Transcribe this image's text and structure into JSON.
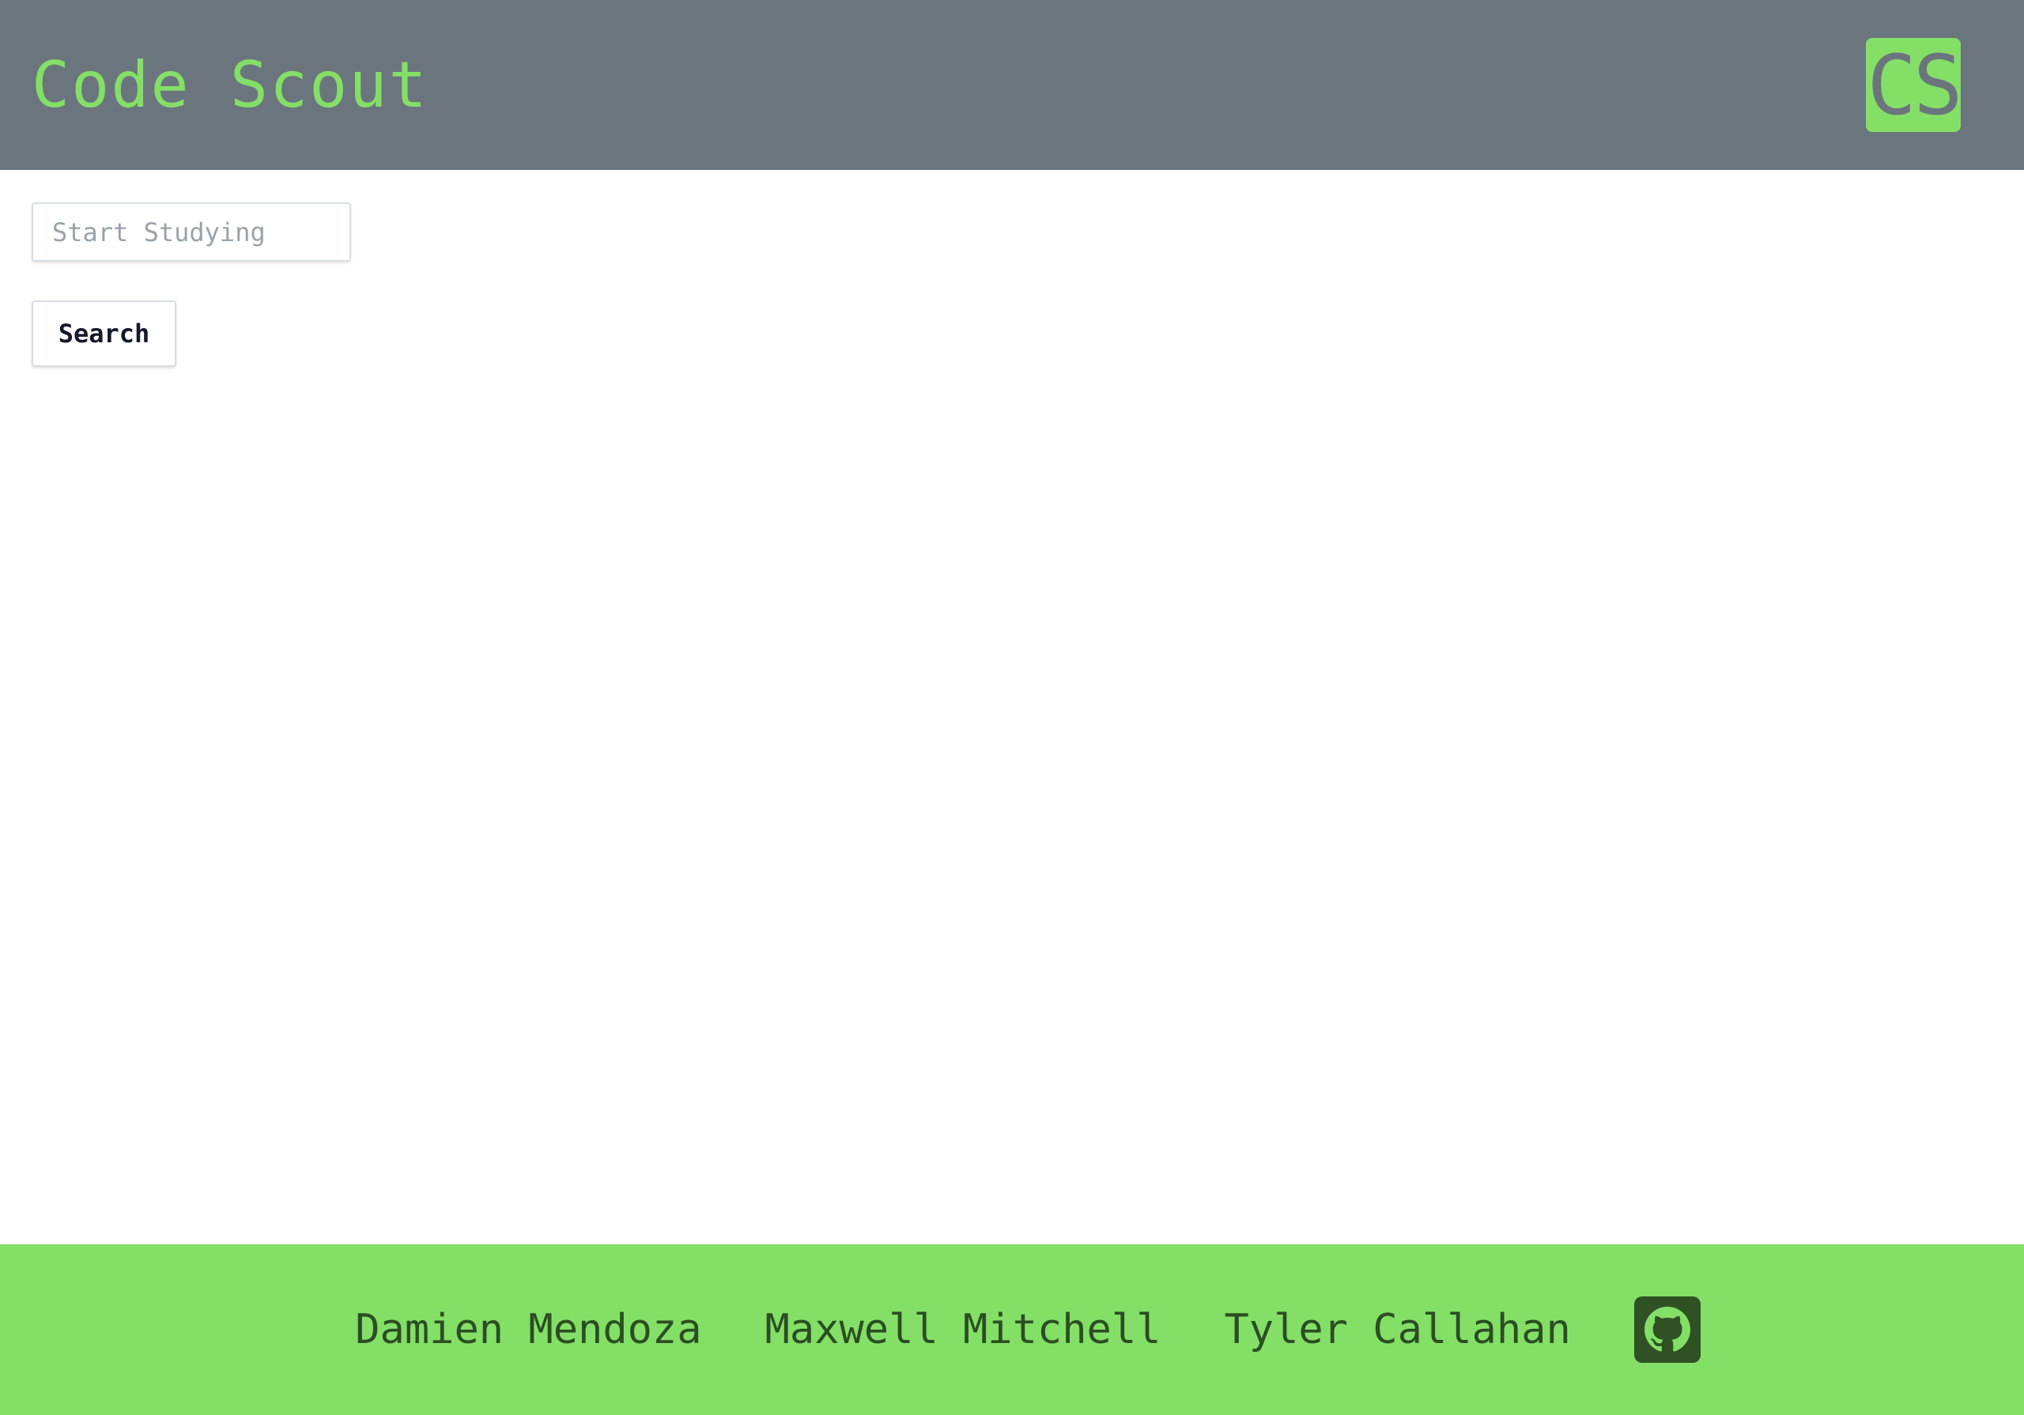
{
  "header": {
    "title": "Code Scout",
    "logo_text": "CS"
  },
  "search": {
    "placeholder": "Start Studying",
    "value": "",
    "button_label": "Search"
  },
  "footer": {
    "authors": [
      "Damien Mendoza",
      "Maxwell Mitchell",
      "Tyler Callahan"
    ],
    "icon": "github-icon"
  },
  "colors": {
    "header_bg": "#6b757d",
    "accent_green": "#84df67",
    "footer_text": "#2b4e22",
    "github_bg": "#2f5124"
  }
}
